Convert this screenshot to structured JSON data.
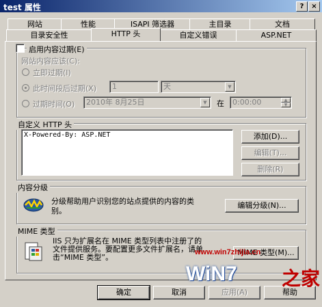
{
  "window": {
    "title": "test 属性",
    "help_btn": "?",
    "close_btn": "×"
  },
  "tabs_row1": [
    "网站",
    "性能",
    "ISAPI 筛选器",
    "主目录",
    "文档"
  ],
  "tabs_row2": [
    "目录安全性",
    "HTTP 头",
    "自定义错误",
    "ASP.NET"
  ],
  "expire": {
    "checkbox_label": "启用内容过期(E)",
    "heading": "网站内容应该(C):",
    "opt_now": "立即过期(I)",
    "opt_after": "此时间段后过期(X)",
    "after_value": "1",
    "after_unit": "天",
    "opt_on": "过期时间(O)",
    "date_value": "2010年 8月25日",
    "at_label": "在",
    "time_value": "0:00:00"
  },
  "custom_headers": {
    "title": "自定义 HTTP 头",
    "items": [
      "X-Powered-By: ASP.NET"
    ],
    "add_btn": "添加(D)...",
    "edit_btn": "编辑(T)...",
    "delete_btn": "删除(R)"
  },
  "rating": {
    "title": "内容分级",
    "description": "分级帮助用户识别您的站点提供的内容的类别。",
    "edit_btn": "编辑分级(N)..."
  },
  "mime": {
    "title": "MIME 类型",
    "description": "IIS 只为扩展名在 MIME 类型列表中注册了的文件提供服务。要配置更多文件扩展名，请单击“MIME 类型”。",
    "btn": "MIME 类型(M)..."
  },
  "footer": {
    "ok": "确定",
    "cancel": "取消",
    "apply": "应用(A)",
    "help": "帮助"
  },
  "watermark": {
    "url": "www.win7zhijia.cn",
    "logo": "WiN7",
    "logo_cn": "之家"
  }
}
